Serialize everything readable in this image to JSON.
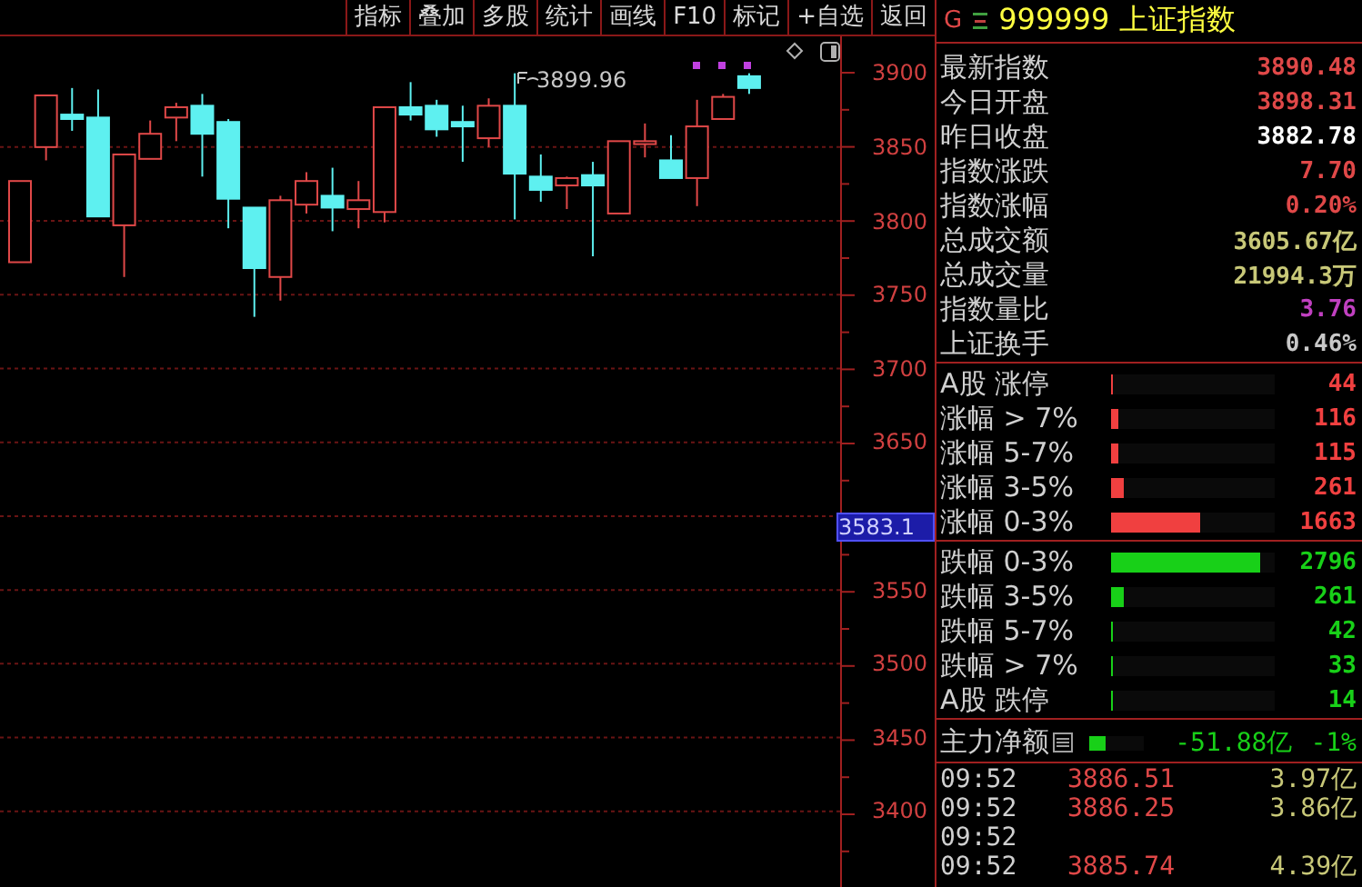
{
  "toolbar": {
    "buttons": [
      "指标",
      "叠加",
      "多股",
      "统计",
      "画线",
      "F10",
      "标记",
      "+自选",
      "返回"
    ]
  },
  "chart": {
    "high_annotation": "3899.96",
    "current_price_tag": "3583.1",
    "chart_data": {
      "type": "candlestick",
      "grid": true,
      "ylim": [
        3350,
        3925
      ],
      "yticks": [
        3900,
        3850,
        3800,
        3750,
        3700,
        3650,
        3550,
        3500,
        3450,
        3400
      ],
      "ohlc": [
        [
          3772,
          3827,
          3772,
          3827
        ],
        [
          3850,
          3885,
          3841,
          3885
        ],
        [
          3872,
          3890,
          3861,
          3869
        ],
        [
          3870,
          3889,
          3803,
          3803
        ],
        [
          3797,
          3845,
          3762,
          3845
        ],
        [
          3842,
          3868,
          3842,
          3859
        ],
        [
          3870,
          3880,
          3854,
          3877
        ],
        [
          3878,
          3886,
          3830,
          3859
        ],
        [
          3867,
          3869,
          3795,
          3815
        ],
        [
          3809,
          3809,
          3735,
          3768
        ],
        [
          3762,
          3817,
          3746,
          3814
        ],
        [
          3811,
          3833,
          3805,
          3827
        ],
        [
          3817,
          3836,
          3793,
          3809
        ],
        [
          3808,
          3827,
          3795,
          3814
        ],
        [
          3806,
          3877,
          3799,
          3877
        ],
        [
          3877,
          3894,
          3868,
          3872
        ],
        [
          3878,
          3882,
          3857,
          3862
        ],
        [
          3867,
          3878,
          3840,
          3864
        ],
        [
          3856,
          3883,
          3850,
          3878
        ],
        [
          3878,
          3900,
          3801,
          3832
        ],
        [
          3830,
          3845,
          3813,
          3821
        ],
        [
          3824,
          3830,
          3808,
          3829
        ],
        [
          3831,
          3840,
          3776,
          3824
        ],
        [
          3805,
          3854,
          3805,
          3854
        ],
        [
          3852,
          3866,
          3843,
          3854
        ],
        [
          3841,
          3858,
          3829,
          3829
        ],
        [
          3829,
          3882,
          3810,
          3864
        ],
        [
          3869,
          3886,
          3869,
          3884
        ],
        [
          3898,
          3900,
          3886,
          3890
        ]
      ]
    }
  },
  "quote": {
    "market_badge": "G",
    "code": "999999",
    "name": "上证指数"
  },
  "stats": [
    {
      "label": "最新指数",
      "value": "3890.48",
      "color": "#e04848"
    },
    {
      "label": "今日开盘",
      "value": "3898.31",
      "color": "#e04848"
    },
    {
      "label": "昨日收盘",
      "value": "3882.78",
      "color": "#ffffff"
    },
    {
      "label": "指数涨跌",
      "value": "7.70",
      "color": "#e04848"
    },
    {
      "label": "指数涨幅",
      "value": "0.20%",
      "color": "#e04848"
    },
    {
      "label": "总成交额",
      "value": "3605.67亿",
      "color": "#c8c878"
    },
    {
      "label": "总成交量",
      "value": "21994.3万",
      "color": "#c8c878"
    },
    {
      "label": "指数量比",
      "value": "3.76",
      "color": "#c040c0"
    },
    {
      "label": "上证换手",
      "value": "0.46%",
      "color": "#c8c8c8"
    }
  ],
  "breadth_up": [
    {
      "label": "A股 涨停",
      "count": "44",
      "level": 0.01,
      "color": "#f04040"
    },
    {
      "label": "涨幅 > 7%",
      "count": "116",
      "level": 0.04,
      "color": "#f04040"
    },
    {
      "label": "涨幅 5-7%",
      "count": "115",
      "level": 0.04,
      "color": "#f04040"
    },
    {
      "label": "涨幅 3-5%",
      "count": "261",
      "level": 0.08,
      "color": "#f04040"
    },
    {
      "label": "涨幅 0-3%",
      "count": "1663",
      "level": 0.54,
      "color": "#f04040"
    }
  ],
  "breadth_down": [
    {
      "label": "跌幅 0-3%",
      "count": "2796",
      "level": 0.91,
      "color": "#18d018"
    },
    {
      "label": "跌幅 3-5%",
      "count": "261",
      "level": 0.08,
      "color": "#18d018"
    },
    {
      "label": "跌幅 5-7%",
      "count": "42",
      "level": 0.01,
      "color": "#18d018"
    },
    {
      "label": "跌幅 > 7%",
      "count": "33",
      "level": 0.01,
      "color": "#18d018"
    },
    {
      "label": "A股 跌停",
      "count": "14",
      "level": 0.01,
      "color": "#18d018"
    }
  ],
  "main_flow": {
    "label": "主力净额",
    "level": 0.3,
    "amount": "-51.88亿",
    "ratio": "-1%"
  },
  "ticks": [
    {
      "time": "09:52",
      "price": "3886.51",
      "amount": "3.97亿"
    },
    {
      "time": "09:52",
      "price": "3886.25",
      "amount": "3.86亿"
    },
    {
      "time": "09:52"
    },
    {
      "time": "09:52",
      "price": "3885.74",
      "amount": "4.39亿"
    }
  ]
}
